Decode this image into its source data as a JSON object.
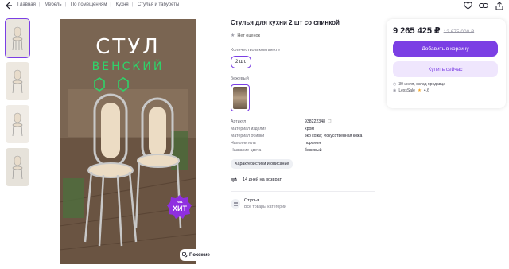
{
  "breadcrumbs": [
    "Главная",
    "Мебель",
    "По помещениям",
    "Кухня",
    "Стулья и табуреты"
  ],
  "product": {
    "title": "Стулья для кухни 2 шт со спинкой",
    "rating_text": "Нет оценок",
    "qty_label": "Количество в комплекте",
    "qty_value": "2 шт.",
    "color_label": "бежевый",
    "image_text_line1": "СТУЛ",
    "image_text_line2": "ВЕНСКИЙ",
    "badge_top": "№1",
    "badge_main": "ХИТ",
    "similar_label": "Похожие"
  },
  "specs": [
    {
      "k": "Артикул",
      "v": "938222348"
    },
    {
      "k": "Материал изделия",
      "v": "хром"
    },
    {
      "k": "Материал обивки",
      "v": "эко кожа; Искусственная кожа"
    },
    {
      "k": "Наполнитель",
      "v": "поролон"
    },
    {
      "k": "Название цвета",
      "v": "бежевый"
    }
  ],
  "characteristics_button": "Характеристики и описание",
  "return_text": "14 дней на возврат",
  "category": {
    "name": "Стулья",
    "sub": "Все товары категории"
  },
  "buy": {
    "price": "9 265 425 ₽",
    "old_price": "12 675 000 ₽",
    "cart_button": "Добавить в корзину",
    "buy_now_button": "Купить сейчас",
    "delivery": "30 июля, склад продавца",
    "seller": "LexsSale",
    "seller_rating": "4,6"
  },
  "colors": {
    "accent": "#7b3fe4",
    "accent_light": "#efe6fd",
    "green": "#2fd36a"
  }
}
